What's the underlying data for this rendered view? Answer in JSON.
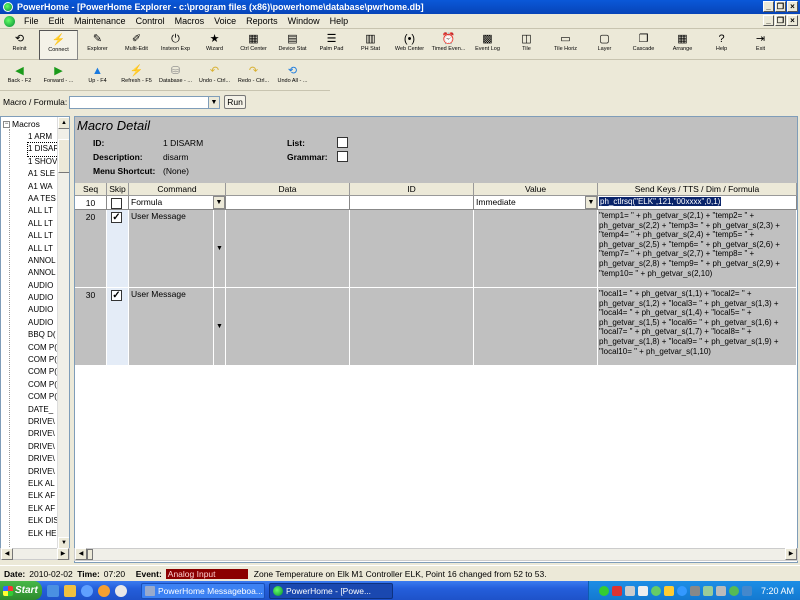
{
  "window": {
    "title": "PowerHome  - [PowerHome Explorer - c:\\program files (x86)\\powerhome\\database\\pwrhome.db]"
  },
  "menu": [
    "File",
    "Edit",
    "Maintenance",
    "Control",
    "Macros",
    "Voice",
    "Reports",
    "Window",
    "Help"
  ],
  "toolbar1": [
    {
      "label": "Reinit",
      "icon": "⟲"
    },
    {
      "label": "Connect",
      "icon": "⚡"
    },
    {
      "label": "Explorer",
      "icon": "✎"
    },
    {
      "label": "Multi-Edit",
      "icon": "✐"
    },
    {
      "label": "Insteon Exp",
      "icon": "⏻"
    },
    {
      "label": "Wizard",
      "icon": "★"
    },
    {
      "label": "Ctrl Center",
      "icon": "▦"
    },
    {
      "label": "Device Stat",
      "icon": "▤"
    },
    {
      "label": "Palm Pad",
      "icon": "☰"
    },
    {
      "label": "PH Stat",
      "icon": "▥"
    },
    {
      "label": "Web Center",
      "icon": "(•)"
    },
    {
      "label": "Timed Even...",
      "icon": "⏰"
    },
    {
      "label": "Event Log",
      "icon": "▩"
    },
    {
      "label": "Tile",
      "icon": "◫"
    },
    {
      "label": "Tile Horiz",
      "icon": "▭"
    },
    {
      "label": "Layer",
      "icon": "▢"
    },
    {
      "label": "Cascade",
      "icon": "❐"
    },
    {
      "label": "Arrange",
      "icon": "▦"
    },
    {
      "label": "Help",
      "icon": "?"
    },
    {
      "label": "Exit",
      "icon": "⇥"
    }
  ],
  "toolbar2": [
    {
      "label": "Back - F2",
      "icon": "◀"
    },
    {
      "label": "Forward - ...",
      "icon": "▶"
    },
    {
      "label": "Up - F4",
      "icon": "▲"
    },
    {
      "label": "Refresh - F5",
      "icon": "⚡"
    },
    {
      "label": "Database - ...",
      "icon": "⛁"
    },
    {
      "label": "Undo - Ctrl...",
      "icon": "↶"
    },
    {
      "label": "Redo - Ctrl...",
      "icon": "↷"
    },
    {
      "label": "Undo All - ...",
      "icon": "⟲"
    }
  ],
  "formula_bar": {
    "label": "Macro / Formula:",
    "value": "",
    "run_label": "Run"
  },
  "tree": {
    "root": "Macros",
    "items": [
      "1 ARM",
      "1 DISAR",
      "1 SHOV",
      "A1 SLE",
      "A1 WA",
      "AA TES",
      "ALL LT",
      "ALL LT",
      "ALL LT",
      "ALL LT",
      "ANNOL",
      "ANNOL",
      "AUDIO",
      "AUDIO",
      "AUDIO",
      "AUDIO",
      "BBQ D(",
      "COM P(",
      "COM P(",
      "COM P(",
      "COM P(",
      "COM P(",
      "DATE_",
      "DRIVE\\",
      "DRIVE\\",
      "DRIVE\\",
      "DRIVE\\",
      "DRIVE\\",
      "ELK AL",
      "ELK AF",
      "ELK AF",
      "ELK DIS",
      "ELK HE"
    ],
    "selected_index": 1
  },
  "detail": {
    "title": "Macro Detail",
    "id_label": "ID:",
    "id_value": "1 DISARM",
    "description_label": "Description:",
    "description_value": "disarm",
    "shortcut_label": "Menu Shortcut:",
    "shortcut_value": "(None)",
    "list_label": "List:",
    "grammar_label": "Grammar:"
  },
  "grid": {
    "headers": {
      "seq": "Seq",
      "skip": "Skip",
      "command": "Command",
      "data": "Data",
      "id": "ID",
      "value": "Value",
      "sendkeys": "Send Keys / TTS / Dim / Formula"
    },
    "rows": [
      {
        "seq": "10",
        "skip": false,
        "command": "Formula",
        "value": "Immediate",
        "sendkeys": "ph_ctlrsq(\"ELK\",121,\"00xxxx\",0,1)"
      },
      {
        "seq": "20",
        "skip": true,
        "command": "User Message",
        "value": "",
        "sendkeys": "\"temp1= \" + ph_getvar_s(2,1) + \"temp2= \" +\nph_getvar_s(2,2) + \"temp3= \" + ph_getvar_s(2,3) +\n\"temp4= \" + ph_getvar_s(2,4) + \"temp5= \" +\nph_getvar_s(2,5) + \"temp6= \" + ph_getvar_s(2,6) +\n\"temp7= \" + ph_getvar_s(2,7) + \"temp8= \" +\nph_getvar_s(2,8) + \"temp9= \" + ph_getvar_s(2,9) +\n\"temp10= \" + ph_getvar_s(2,10)"
      },
      {
        "seq": "30",
        "skip": true,
        "command": "User Message",
        "value": "",
        "sendkeys": "\"local1= \" + ph_getvar_s(1,1) + \"local2= \" +\nph_getvar_s(1,2) + \"local3= \" + ph_getvar_s(1,3) +\n\"local4= \" + ph_getvar_s(1,4) + \"local5= \" +\nph_getvar_s(1,5) + \"local6= \" + ph_getvar_s(1,6) +\n\"local7= \" + ph_getvar_s(1,7) + \"local8= \" +\nph_getvar_s(1,8) + \"local9= \" + ph_getvar_s(1,9) +\n\"local10= \" + ph_getvar_s(1,10)"
      }
    ]
  },
  "status": {
    "date_label": "Date:",
    "date": "2010-02-02",
    "time_label": "Time:",
    "time": "07:20",
    "event_label": "Event:",
    "event": "Analog Input",
    "message": "Zone Temperature on Elk M1 Controller ELK, Point 16 changed from 52 to 53."
  },
  "taskbar": {
    "start": "Start",
    "tasks": [
      "PowerHome Messageboa...",
      "PowerHome  - [Powe..."
    ],
    "clock": "7:20 AM"
  },
  "colors": {
    "titlebar": "#0a58d8",
    "grid_bg": "#c0c0c0",
    "event_badge": "#8b0000",
    "selection": "#0a246a"
  }
}
